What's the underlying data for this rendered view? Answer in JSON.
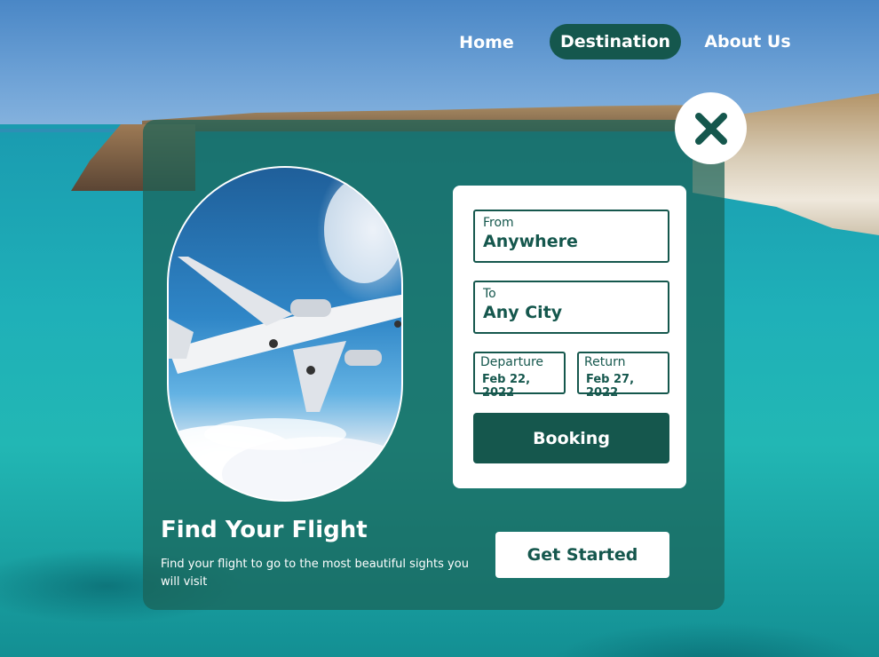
{
  "nav": {
    "home": "Home",
    "destination": "Destination",
    "about": "About Us",
    "active": "Destination"
  },
  "form": {
    "from_label": "From",
    "from_value": "Anywhere",
    "to_label": "To",
    "to_value": "Any City",
    "departure_label": "Departure",
    "departure_value": "Feb 22, 2022",
    "return_label": "Return",
    "return_value": "Feb 27, 2022",
    "booking_label": "Booking"
  },
  "hero": {
    "title": "Find Your Flight",
    "subtitle": "Find your flight to go to the most beautiful sights you will visit",
    "cta_label": "Get Started"
  },
  "icons": {
    "close": "close-icon",
    "photo": "airplane-photo"
  },
  "colors": {
    "primary": "#15574d",
    "card_overlay": "#1a6258",
    "white": "#ffffff"
  }
}
